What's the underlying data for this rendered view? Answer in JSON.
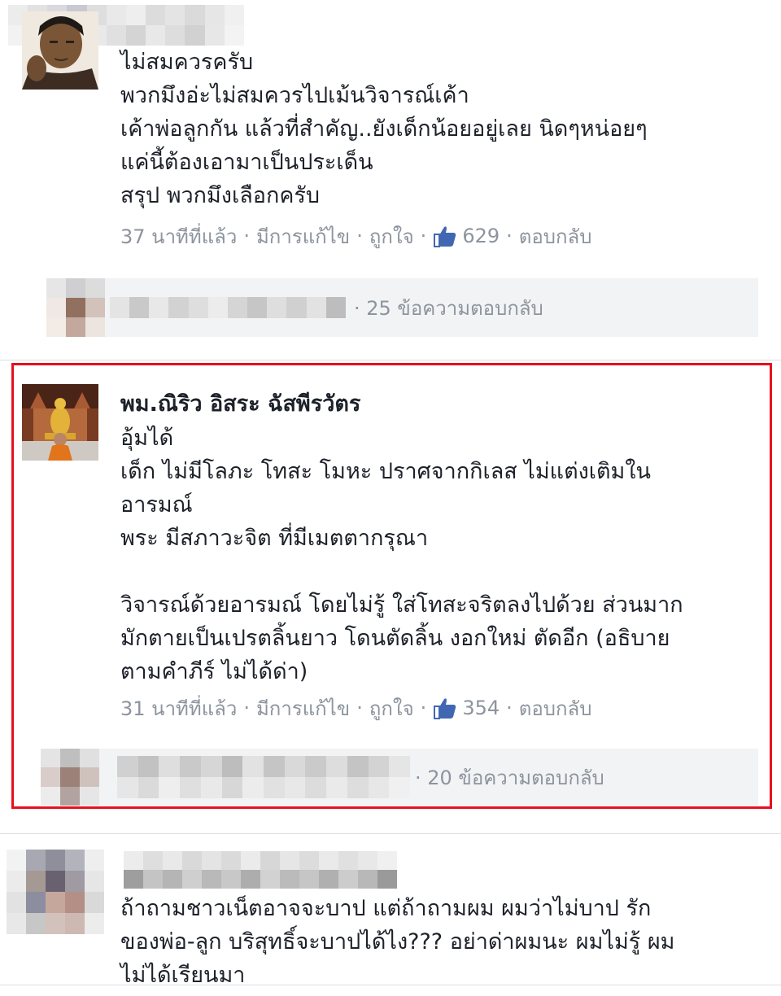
{
  "colors": {
    "highlight": "#e8101e",
    "meta_text": "#8d949e",
    "reply_bar_bg": "#f2f3f5",
    "like_blue": "#4267b2"
  },
  "comments": [
    {
      "author": "",
      "body": "ไม่สมควรครับ\nพวกมึงอ่ะไม่สมควรไปเม้นวิจารณ์เค้า\nเค้าพ่อลูกกัน แล้วที่สำคัญ..ยังเด็กน้อยอยู่เลย นิดๆหน่อยๆ\nแค่นี้ต้องเอามาเป็นประเด็น\nสรุป พวกมึงเลือกครับ",
      "meta": {
        "time": "37 นาทีที่แล้ว",
        "edited": "มีการแก้ไข",
        "like": "ถูกใจ",
        "like_count": "629",
        "reply": "ตอบกลับ",
        "like_icon": "thumbs-up-icon"
      },
      "replies_summary": "25 ข้อความตอบกลับ"
    },
    {
      "author": "พม.ณิริว อิสระ ฉัสพีรวัตร",
      "body": "อุ้มได้\nเด็ก ไม่มีโลภะ โทสะ โมหะ ปราศจากกิเลส ไม่แต่งเติมใน\nอารมณ์\nพระ มีสภาวะจิต ที่มีเมตตากรุณา\n\nวิจารณ์ด้วยอารมณ์ โดยไม่รู้ ใส่โทสะจริตลงไปด้วย ส่วนมาก\nมักตายเป็นเปรตลิ้นยาว โดนตัดลิ้น งอกใหม่ ตัดอีก (อธิบาย\nตามคำภีร์ ไม่ได้ด่า)",
      "meta": {
        "time": "31 นาทีที่แล้ว",
        "edited": "มีการแก้ไข",
        "like": "ถูกใจ",
        "like_count": "354",
        "reply": "ตอบกลับ",
        "like_icon": "thumbs-up-icon"
      },
      "replies_summary": "20 ข้อความตอบกลับ"
    },
    {
      "author": "",
      "body": "ถ้าถามชาวเน็ตอาจจะบาป แต่ถ้าถามผม ผมว่าไม่บาป รัก\nของพ่อ-ลูก บริสุทธิ์จะบาปได้ไง??? อย่าด่าผมนะ ผมไม่รู้ ผม\nไม่ได้เรียนมา"
    }
  ]
}
